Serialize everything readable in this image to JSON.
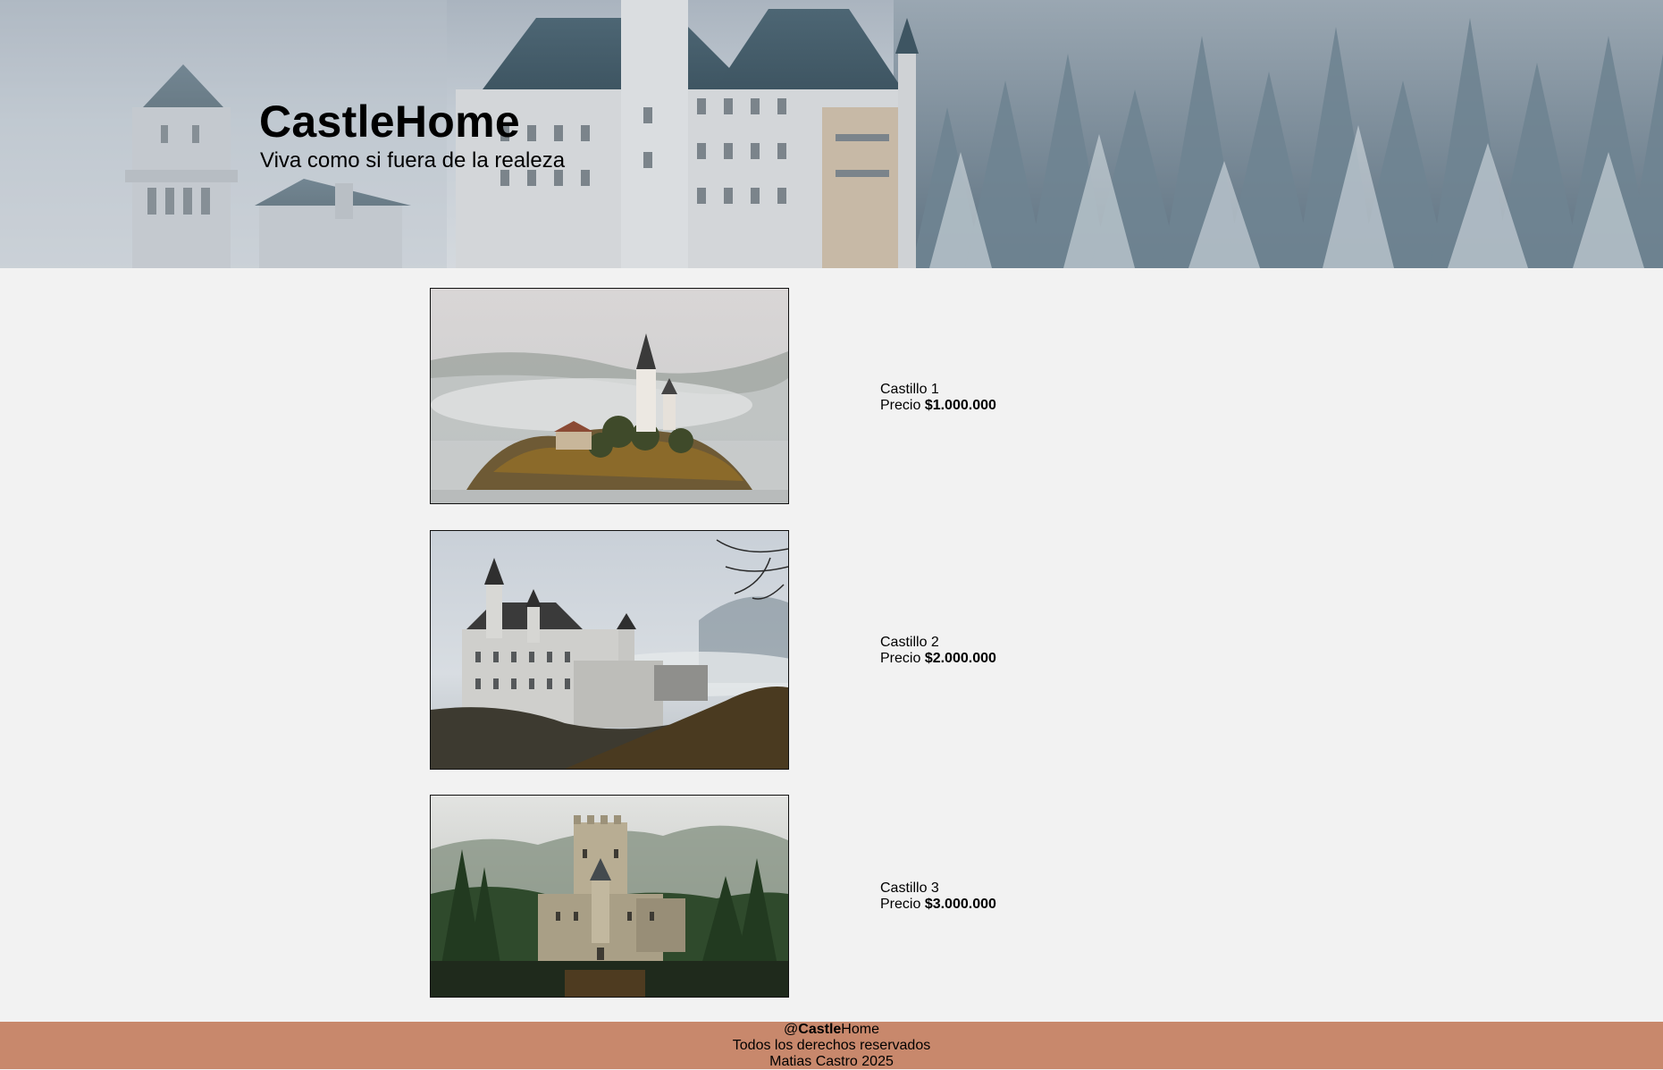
{
  "hero": {
    "title": "CastleHome",
    "subtitle": "Viva como si fuera de la realeza"
  },
  "listings": [
    {
      "name": "Castillo 1",
      "price_label": "Precio",
      "price": "$1.000.000",
      "image_icon": "lake-island-church-photo"
    },
    {
      "name": "Castillo 2",
      "price_label": "Precio",
      "price": "$2.000.000",
      "image_icon": "misty-castle-photo"
    },
    {
      "name": "Castillo 3",
      "price_label": "Precio",
      "price": "$3.000.000",
      "image_icon": "forest-fortress-photo"
    }
  ],
  "footer": {
    "handle_prefix": "@",
    "handle_bold": "Castle",
    "handle_rest": "Home",
    "rights": "Todos los derechos reservados",
    "credit": "Matias Castro 2025"
  },
  "colors": {
    "page_background": "#f2f2f2",
    "footer_background": "#c8886c",
    "text": "#000000"
  }
}
